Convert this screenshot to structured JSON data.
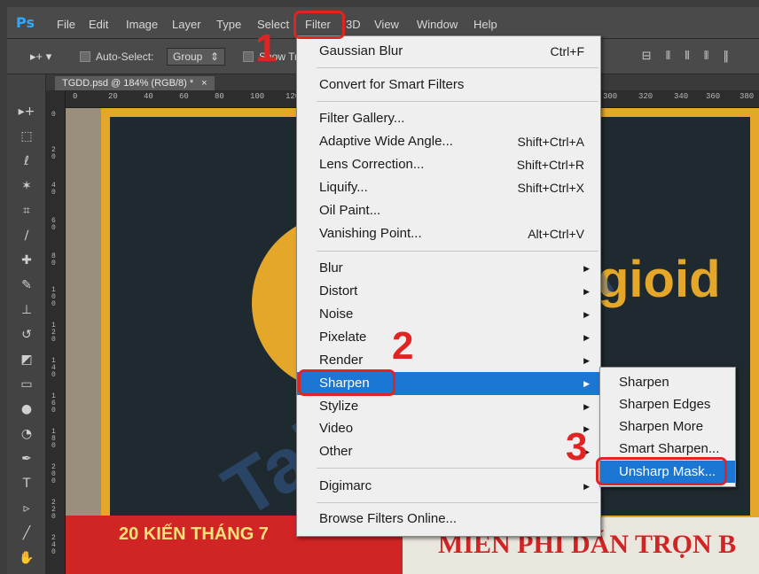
{
  "app": {
    "logo": "Ps"
  },
  "menubar": {
    "items": [
      "File",
      "Edit",
      "Image",
      "Layer",
      "Type",
      "Select",
      "Filter",
      "3D",
      "View",
      "Window",
      "Help"
    ]
  },
  "options_bar": {
    "auto_select_label": "Auto-Select:",
    "group_value": "Group",
    "show_transform_partial": "Show Tr"
  },
  "document": {
    "tab_label": "TGDD.psd @ 184% (RGB/8) *",
    "ruler_h": [
      "0",
      "20",
      "40",
      "60",
      "80",
      "100",
      "120",
      "300",
      "320",
      "340",
      "360",
      "380"
    ],
    "ruler_v": [
      "0",
      "2\n0",
      "4\n0",
      "6\n0",
      "8\n0",
      "1\n0\n0",
      "1\n2\n0",
      "1\n4\n0",
      "1\n6\n0",
      "1\n8\n0",
      "2\n0\n0",
      "2\n2\n0",
      "2\n4\n0"
    ]
  },
  "canvas": {
    "brand_partial": "gioid",
    "banner_text": "MIỄN PHÍ DÁN TRỌN B",
    "banner_left": "20 KIẾN THÁNG 7",
    "watermark": "TaiLieu.com"
  },
  "filter_menu": {
    "items": [
      {
        "label": "Gaussian Blur",
        "shortcut": "Ctrl+F"
      },
      {
        "label": "Convert for Smart Filters",
        "shortcut": ""
      },
      {
        "label": "Filter Gallery...",
        "shortcut": ""
      },
      {
        "label": "Adaptive Wide Angle...",
        "shortcut": "Shift+Ctrl+A"
      },
      {
        "label": "Lens Correction...",
        "shortcut": "Shift+Ctrl+R"
      },
      {
        "label": "Liquify...",
        "shortcut": "Shift+Ctrl+X"
      },
      {
        "label": "Oil Paint...",
        "shortcut": ""
      },
      {
        "label": "Vanishing Point...",
        "shortcut": "Alt+Ctrl+V"
      },
      {
        "label": "Blur",
        "shortcut": ""
      },
      {
        "label": "Distort",
        "shortcut": ""
      },
      {
        "label": "Noise",
        "shortcut": ""
      },
      {
        "label": "Pixelate",
        "shortcut": ""
      },
      {
        "label": "Render",
        "shortcut": ""
      },
      {
        "label": "Sharpen",
        "shortcut": ""
      },
      {
        "label": "Stylize",
        "shortcut": ""
      },
      {
        "label": "Video",
        "shortcut": ""
      },
      {
        "label": "Other",
        "shortcut": ""
      },
      {
        "label": "Digimarc",
        "shortcut": ""
      },
      {
        "label": "Browse Filters Online...",
        "shortcut": ""
      }
    ],
    "arrow": "▶"
  },
  "sharpen_submenu": {
    "items": [
      "Sharpen",
      "Sharpen Edges",
      "Sharpen More",
      "Smart Sharpen...",
      "Unsharp Mask..."
    ]
  },
  "annotations": [
    "1",
    "2",
    "3"
  ],
  "colors": {
    "accent": "#1b77d3",
    "annotation": "#e02424",
    "ps_blue": "#31a8ff"
  }
}
